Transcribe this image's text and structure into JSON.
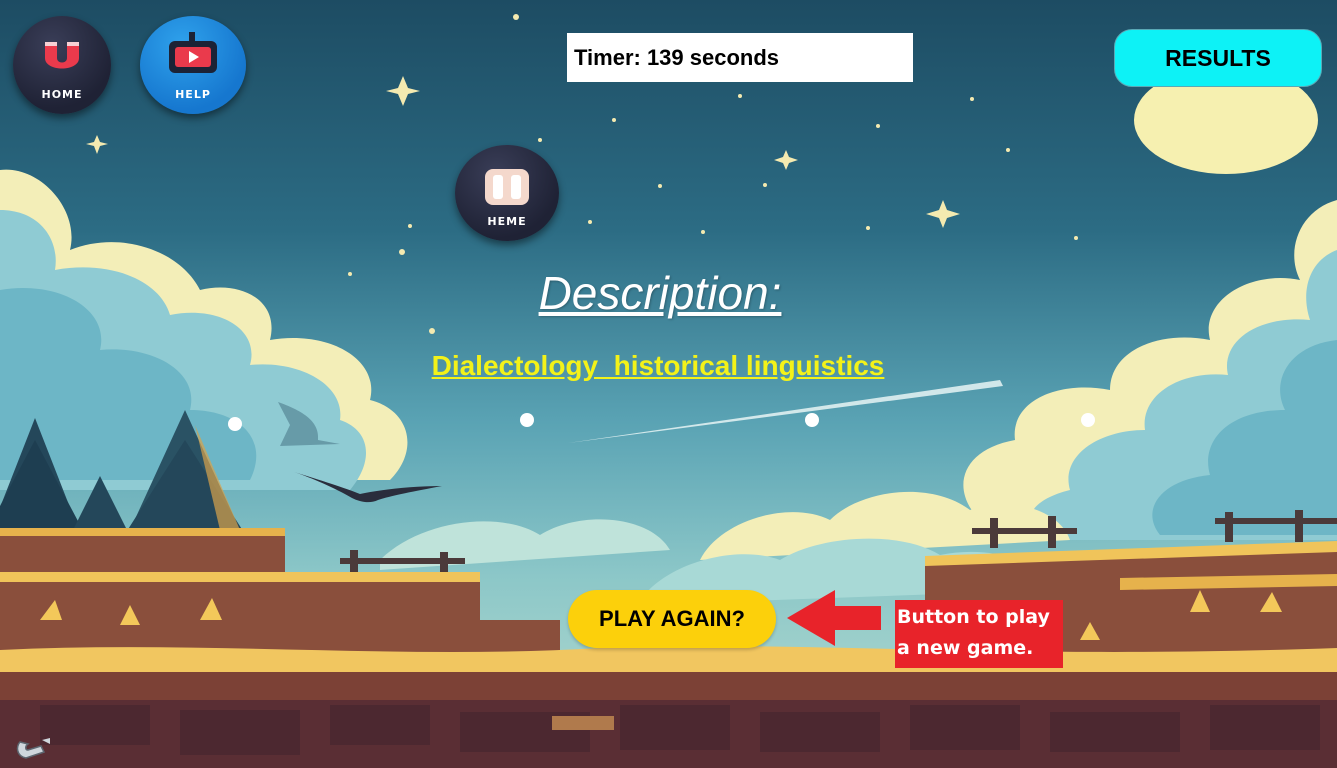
{
  "nav": {
    "home_label": "HOME",
    "help_label": "HELP",
    "theme_label": "HEME"
  },
  "timer": {
    "text": "Timer: 139 seconds",
    "seconds": 139
  },
  "results_label": "RESULTS",
  "description": {
    "title": "Description:",
    "text": "Dialectology  historical linguistics"
  },
  "play_again_label": "PLAY AGAIN?",
  "annotation": {
    "line1": "Button to play",
    "line2": "a new game."
  },
  "colors": {
    "results_bg": "#0df2f6",
    "play_again_bg": "#fcd00b",
    "description_text": "#f3f219",
    "annotation_bg": "#e8232a",
    "help_button": "#1677cf",
    "home_button": "#1f2235"
  },
  "icons": {
    "home": "magnet-icon",
    "help": "tv-play-icon",
    "theme": "pause-icon",
    "annotation": "left-arrow-icon",
    "corner": "magnet-small-icon"
  }
}
